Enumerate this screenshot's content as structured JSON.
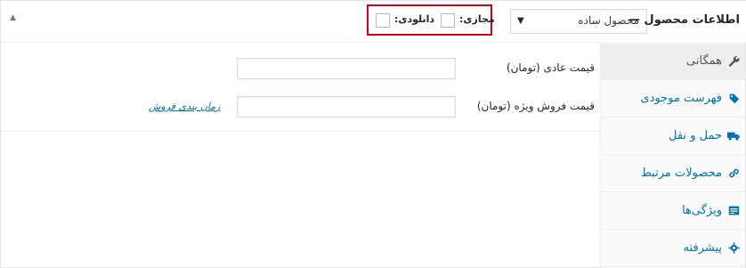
{
  "header": {
    "title": "اطلاعات محصول —",
    "product_type": {
      "selected": "محصول ساده",
      "arrow": "▼"
    },
    "collapse_arrow": "▲",
    "options": {
      "virtual_label": "مجازی:",
      "download_label": "دانلودی:",
      "virtual_checked": false,
      "download_checked": false,
      "highlight_color": "#d0021b"
    }
  },
  "tabs": [
    {
      "label": "همگانی",
      "icon": "wrench-icon",
      "glyph": "🔧",
      "active": true
    },
    {
      "label": "فهرست موجودی",
      "icon": "tag-icon",
      "glyph": "◆",
      "active": false
    },
    {
      "label": "حمل و نقل",
      "icon": "truck-icon",
      "glyph": "■",
      "active": false
    },
    {
      "label": "محصولات مرتبط",
      "icon": "link-icon",
      "glyph": "∞",
      "active": false
    },
    {
      "label": "ویژگی‌ها",
      "icon": "list-icon",
      "glyph": "▤",
      "active": false
    },
    {
      "label": "پیشرفته",
      "icon": "gear-icon",
      "glyph": "✱",
      "active": false
    }
  ],
  "general": {
    "regular_price_label": "قیمت عادی (تومان)",
    "regular_price_value": "",
    "sale_price_label": "قیمت فروش ویژه (تومان)",
    "sale_price_value": "",
    "schedule_link": "زمان بندی فروش"
  },
  "colors": {
    "link": "#0073aa",
    "border": "#eeeeee"
  }
}
